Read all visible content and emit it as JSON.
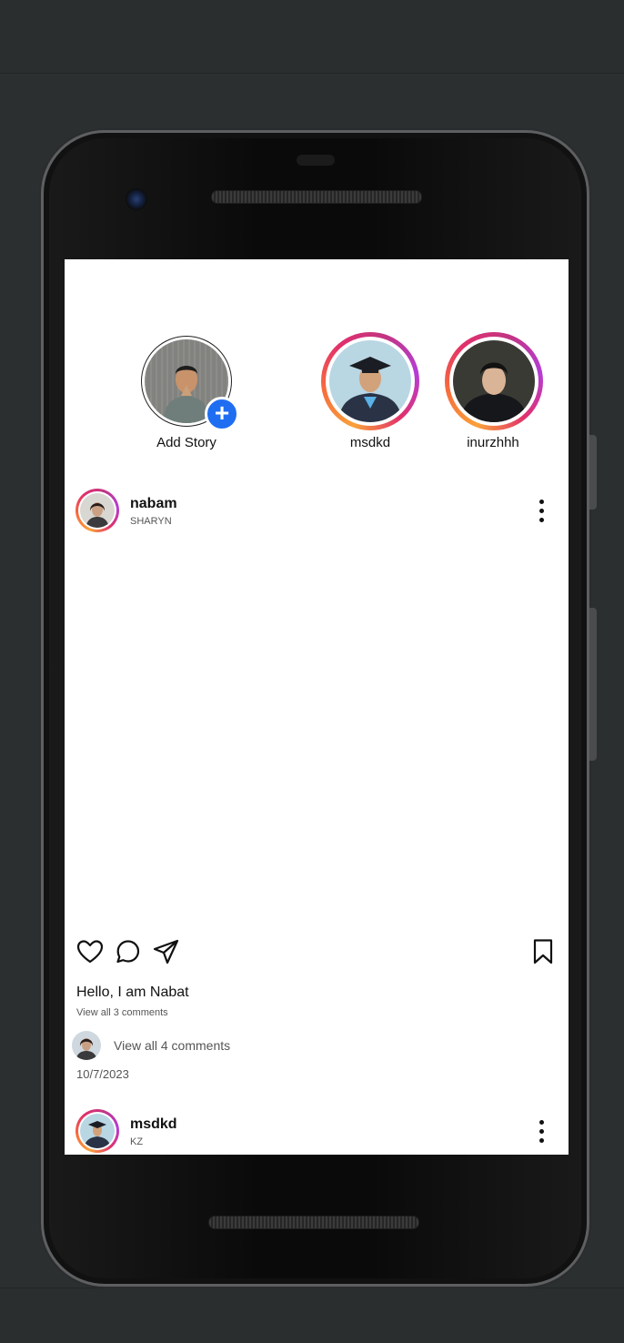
{
  "stories": [
    {
      "label": "Add Story",
      "is_own": true
    },
    {
      "label": "msdkd",
      "is_own": false
    },
    {
      "label": "inurzhhh",
      "is_own": false
    }
  ],
  "posts": [
    {
      "username": "nabam",
      "subtitle": "SHARYN",
      "caption": "Hello, I am Nabat",
      "view_comments_small": "View all 3 comments",
      "view_comments": "View all 4 comments",
      "date": "10/7/2023"
    },
    {
      "username": "msdkd",
      "subtitle": "KZ"
    }
  ],
  "icons": {
    "like": "heart-icon",
    "comment": "comment-icon",
    "share": "send-icon",
    "save": "bookmark-icon",
    "add": "plus-icon",
    "more": "more-vertical-icon"
  },
  "colors": {
    "add_button": "#1f6ef2",
    "story_ring": [
      "#f9a13a",
      "#e1306c",
      "#b53dd6"
    ],
    "background": "#2b2f30"
  }
}
